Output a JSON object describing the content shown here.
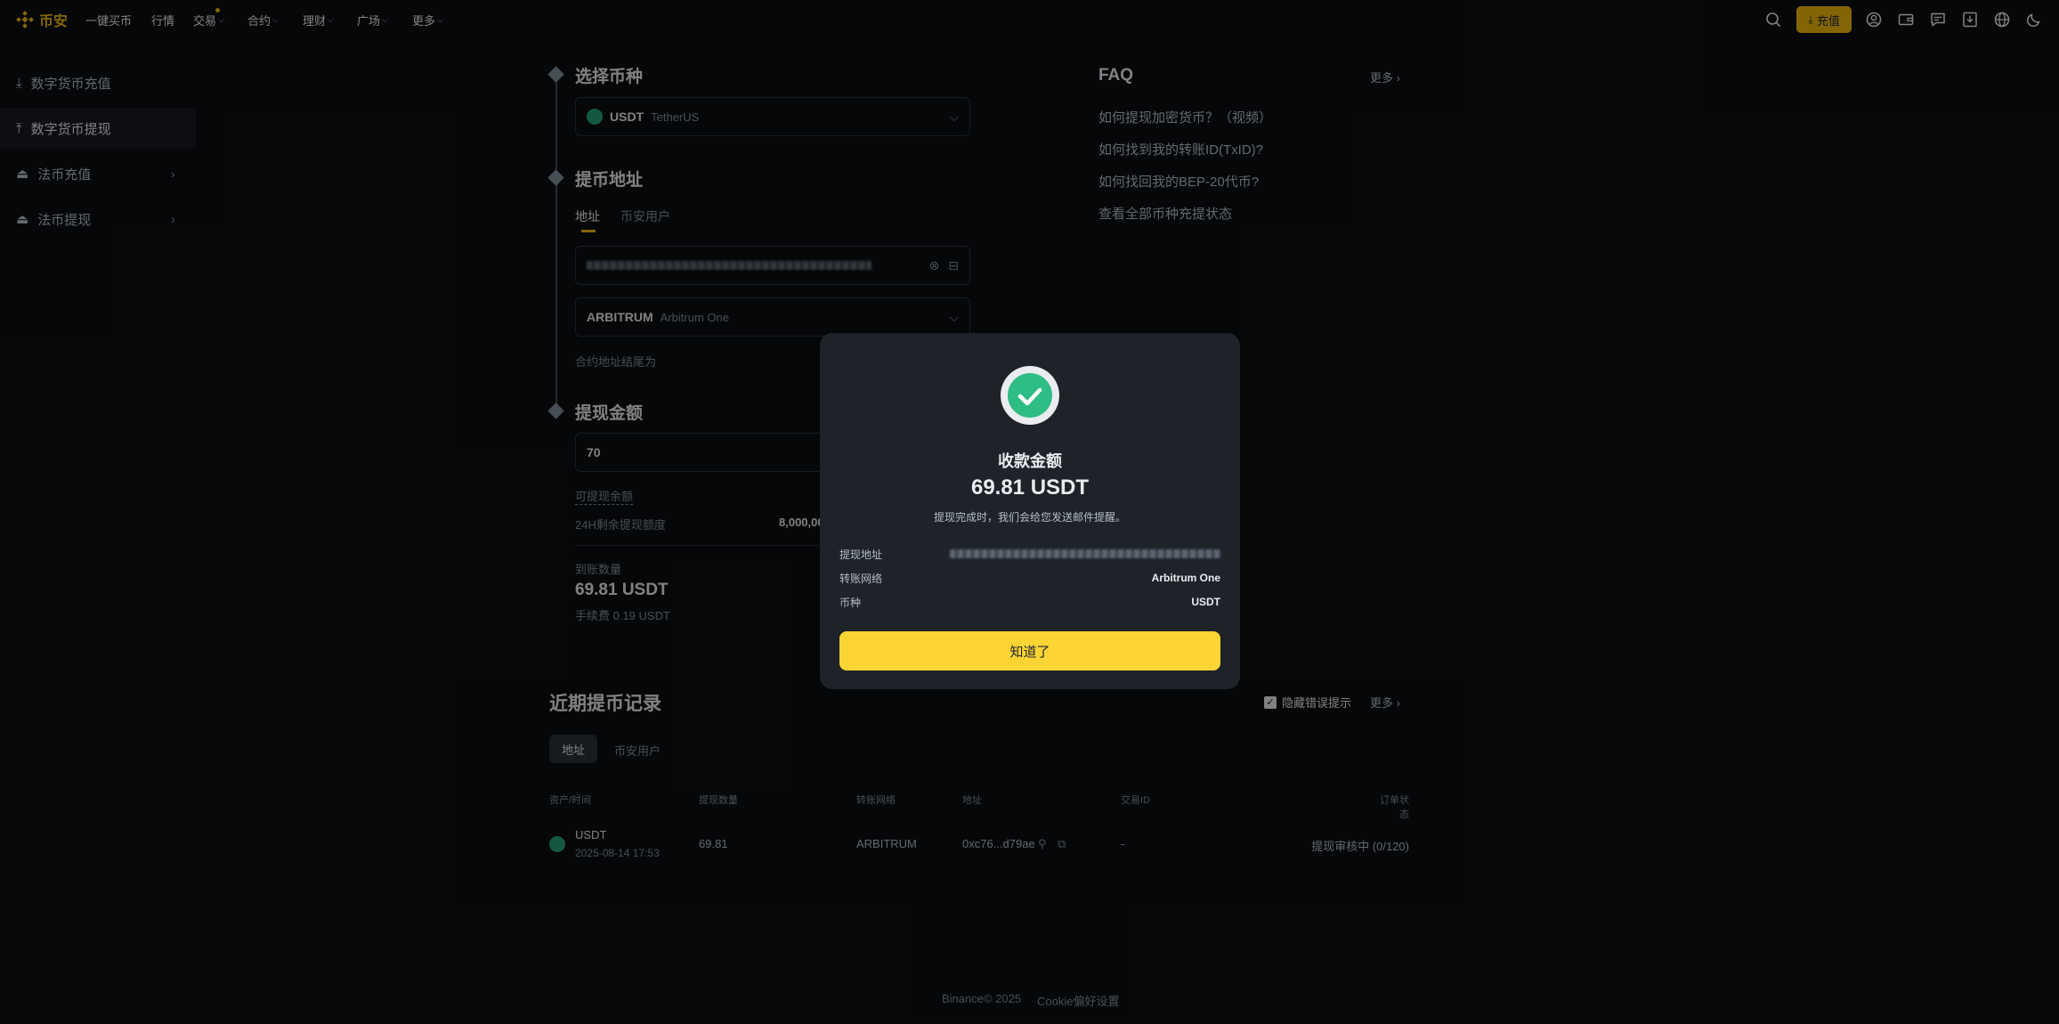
{
  "brand": {
    "name": "币安",
    "accent": "#f0b90b"
  },
  "nav": {
    "items": [
      {
        "label": "一键买币",
        "has_menu": false
      },
      {
        "label": "行情",
        "has_menu": false
      },
      {
        "label": "交易",
        "has_menu": true
      },
      {
        "label": "合约",
        "has_menu": true
      },
      {
        "label": "理财",
        "has_menu": true
      },
      {
        "label": "广场",
        "has_menu": true
      },
      {
        "label": "更多",
        "has_menu": true
      }
    ],
    "deposit_label": "充值",
    "icons": [
      "search-icon",
      "deposit-icon",
      "user-icon",
      "wallet-icon",
      "message-icon",
      "download-icon",
      "globe-icon",
      "moon-icon"
    ]
  },
  "sidebar": {
    "items": [
      {
        "label": "数字货币充值",
        "icon": "download-icon"
      },
      {
        "label": "数字货币提现",
        "icon": "upload-icon"
      },
      {
        "label": "法币充值",
        "icon": "bank-icon"
      },
      {
        "label": "法币提现",
        "icon": "bank-icon"
      }
    ]
  },
  "form": {
    "step1_title": "选择币种",
    "coin": {
      "symbol": "USDT",
      "name": "TetherUS"
    },
    "step2_title": "提币地址",
    "address_tabs": [
      "地址",
      "币安用户"
    ],
    "network": {
      "code": "ARBITRUM",
      "name": "Arbitrum One"
    },
    "contract_hint": "合约地址结尾为",
    "step3_title": "提现金额",
    "amount_value": "70",
    "available_label": "可提现余额",
    "limit_label": "24H剩余提现额度",
    "limit_value": "8,000,00",
    "receive_label": "到账数量",
    "receive_value": "69.81 USDT",
    "fee_text": "手续费 0.19 USDT"
  },
  "faq": {
    "title": "FAQ",
    "more": "更多",
    "questions": [
      "如何提现加密货币？（视频）",
      "如何找到我的转账ID(TxID)?",
      "如何找回我的BEP-20代币?",
      "查看全部币种充提状态"
    ]
  },
  "records": {
    "title": "近期提币记录",
    "hide_errors_label": "隐藏错误提示",
    "more": "更多",
    "tabs": [
      "地址",
      "币安用户"
    ],
    "columns": [
      "资产/时间",
      "提现数量",
      "转账网络",
      "地址",
      "交易ID",
      "订单状态"
    ],
    "rows": [
      {
        "asset": "USDT",
        "time": "2025-08-14 17:53",
        "amount": "69.81",
        "network": "ARBITRUM",
        "address": "0xc76...d79ae",
        "txid": "-",
        "status": "提现审核中 (0/120)"
      }
    ]
  },
  "modal": {
    "title": "收款金额",
    "amount": "69.81 USDT",
    "subtitle": "提现完成时，我们会给您发送邮件提醒。",
    "rows": [
      {
        "label": "提现地址",
        "value": ""
      },
      {
        "label": "转账网络",
        "value": "Arbitrum One"
      },
      {
        "label": "币种",
        "value": "USDT"
      }
    ],
    "ok_label": "知道了",
    "success_color": "#2ebd85",
    "button_color": "#fcd535"
  },
  "footer": {
    "copyright": "Binance© 2025",
    "cookie": "Cookie偏好设置"
  }
}
